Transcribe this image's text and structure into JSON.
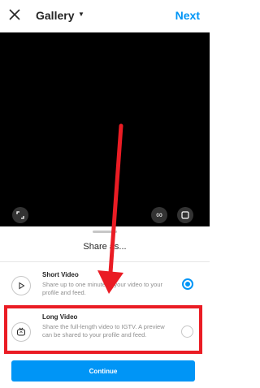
{
  "header": {
    "title": "Gallery",
    "next_label": "Next"
  },
  "sheet": {
    "title": "Share as..."
  },
  "options": [
    {
      "title": "Short Video",
      "description": "Share up to one minute of your video to your profile and feed.",
      "selected": true
    },
    {
      "title": "Long Video",
      "description": "Share the full-length video to IGTV. A preview can be shared to your profile and feed.",
      "selected": false
    }
  ],
  "continue_label": "Continue",
  "colors": {
    "accent": "#0095f6",
    "annotation": "#ea1c24"
  }
}
